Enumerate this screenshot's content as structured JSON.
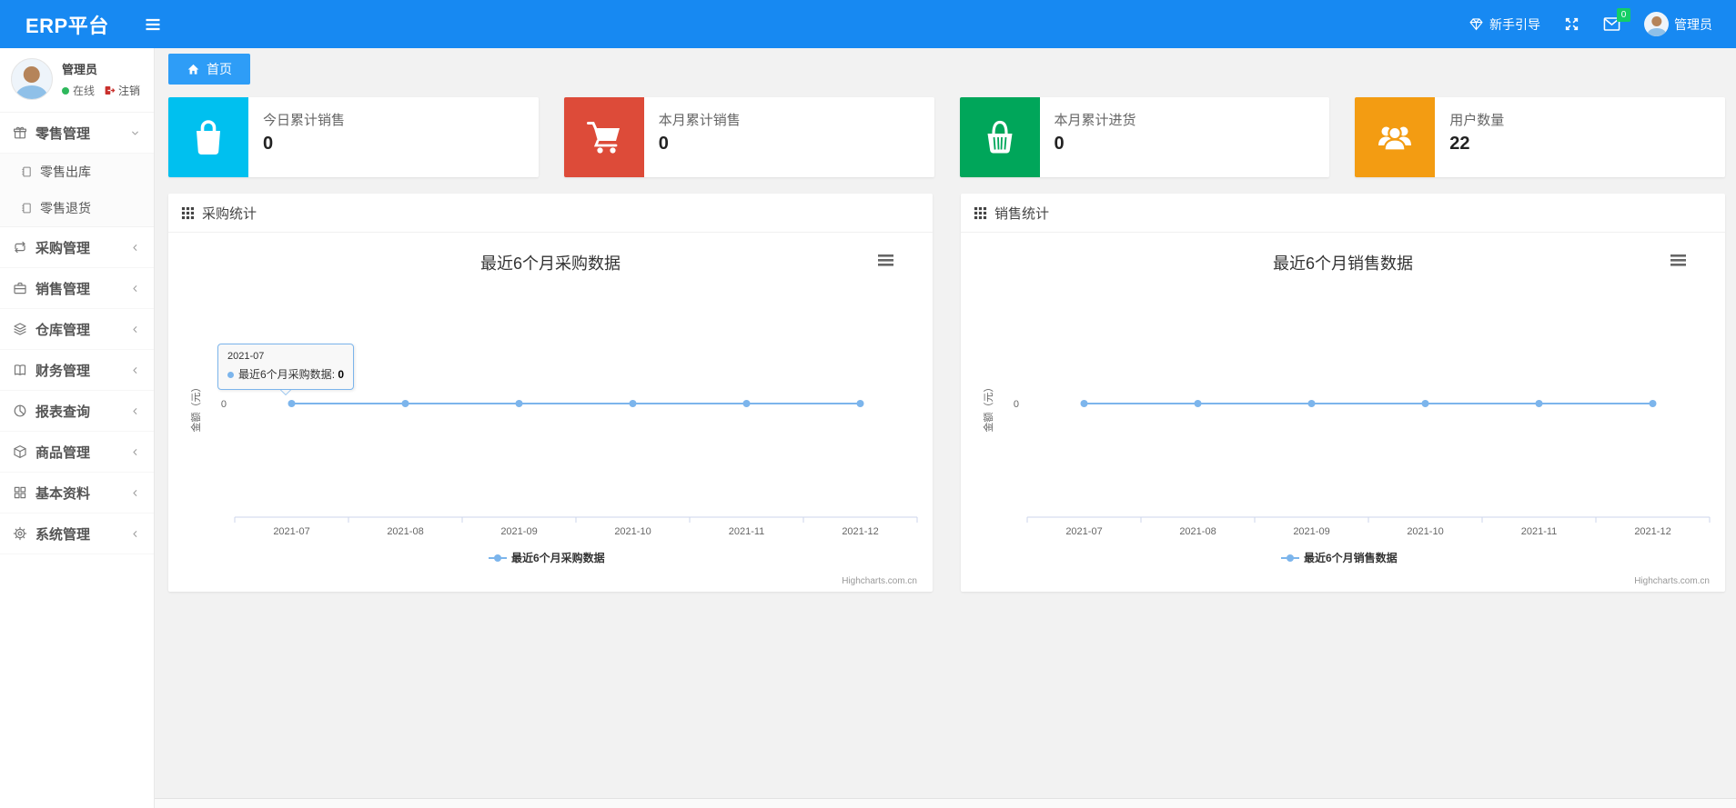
{
  "colors": {
    "navbar": "#1789f2",
    "tab_active": "#2e9df7",
    "series": "#7cb5ec",
    "badge_green": "#13ce66",
    "axis_line": "#ccd6eb"
  },
  "navbar": {
    "brand": "ERP平台",
    "guide_label": "新手引导",
    "mail_badge": "0",
    "user_name": "管理员"
  },
  "sidebar": {
    "user": {
      "name": "管理员",
      "status": "在线",
      "logout_label": "注销"
    },
    "menu": [
      {
        "icon": "gift-icon",
        "label": "零售管理",
        "state": "expanded",
        "children": [
          {
            "icon": "notebook-icon",
            "label": "零售出库"
          },
          {
            "icon": "notebook-icon",
            "label": "零售退货"
          }
        ]
      },
      {
        "icon": "repeat-icon",
        "label": "采购管理",
        "state": "collapsed"
      },
      {
        "icon": "briefcase-icon",
        "label": "销售管理",
        "state": "collapsed"
      },
      {
        "icon": "layers-icon",
        "label": "仓库管理",
        "state": "collapsed"
      },
      {
        "icon": "book-icon",
        "label": "财务管理",
        "state": "collapsed"
      },
      {
        "icon": "pie-chart-icon",
        "label": "报表查询",
        "state": "collapsed"
      },
      {
        "icon": "cube-icon",
        "label": "商品管理",
        "state": "collapsed"
      },
      {
        "icon": "grid-icon",
        "label": "基本资料",
        "state": "collapsed"
      },
      {
        "icon": "gear-icon",
        "label": "系统管理",
        "state": "collapsed"
      }
    ]
  },
  "tabs": [
    {
      "label": "首页",
      "active": true
    }
  ],
  "stat_cards": [
    {
      "label": "今日累计销售",
      "value": "0",
      "color": "#00c0ef",
      "icon": "shopping-bag-icon"
    },
    {
      "label": "本月累计销售",
      "value": "0",
      "color": "#dd4b39",
      "icon": "shopping-cart-icon"
    },
    {
      "label": "本月累计进货",
      "value": "0",
      "color": "#00a65a",
      "icon": "shopping-basket-icon"
    },
    {
      "label": "用户数量",
      "value": "22",
      "color": "#f39c12",
      "icon": "user-group-icon"
    }
  ],
  "panels": [
    {
      "header": "采购统计"
    },
    {
      "header": "销售统计"
    }
  ],
  "chart_data": [
    {
      "type": "line",
      "title": "最近6个月采购数据",
      "categories": [
        "2021-07",
        "2021-08",
        "2021-09",
        "2021-10",
        "2021-11",
        "2021-12"
      ],
      "series": [
        {
          "name": "最近6个月采购数据",
          "values": [
            0,
            0,
            0,
            0,
            0,
            0
          ],
          "color": "#7cb5ec"
        }
      ],
      "xlabel": "",
      "ylabel": "金额（元）",
      "yticks": [
        "0"
      ],
      "grid": false,
      "legend_position": "bottom",
      "watermark": "Highcharts.com.cn",
      "tooltip": {
        "visible": true,
        "category": "2021-07",
        "series": "最近6个月采购数据",
        "separator": ": ",
        "value": "0"
      }
    },
    {
      "type": "line",
      "title": "最近6个月销售数据",
      "categories": [
        "2021-07",
        "2021-08",
        "2021-09",
        "2021-10",
        "2021-11",
        "2021-12"
      ],
      "series": [
        {
          "name": "最近6个月销售数据",
          "values": [
            0,
            0,
            0,
            0,
            0,
            0
          ],
          "color": "#7cb5ec"
        }
      ],
      "xlabel": "",
      "ylabel": "金额（元）",
      "yticks": [
        "0"
      ],
      "grid": false,
      "legend_position": "bottom",
      "watermark": "Highcharts.com.cn",
      "tooltip": {
        "visible": false
      }
    }
  ]
}
